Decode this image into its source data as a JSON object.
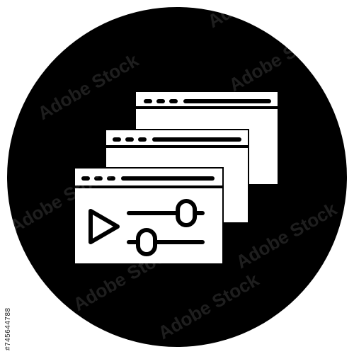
{
  "icon": {
    "name": "media-player-windows-icon",
    "description_tag": "video-editing-windows",
    "background_circle_color": "#000000",
    "foreground_color": "#ffffff",
    "page_background": "#ffffff"
  },
  "watermark": {
    "text": "Adobe Stock",
    "color": "#ffffff",
    "opacity_level": 0.12
  },
  "stock_id": {
    "text": "#745644788"
  },
  "slider_levels": {
    "top": 0.78,
    "bottom": 0.24
  }
}
